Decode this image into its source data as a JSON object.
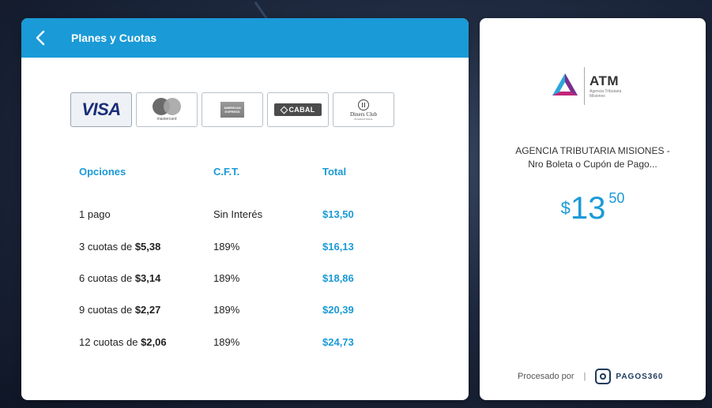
{
  "header": {
    "title": "Planes y Cuotas"
  },
  "cards": {
    "visa": "VISA",
    "mastercard": "mastercard",
    "amex": "AMERICAN EXPRESS",
    "cabal": "CABAL",
    "diners": "Diners Club",
    "diners_sub": "INTERNATIONAL"
  },
  "table": {
    "headers": [
      "Opciones",
      "C.F.T.",
      "Total"
    ],
    "rows": [
      {
        "option_prefix": "1 pago",
        "option_amount": "",
        "cft": "Sin Interés",
        "total": "$13,50"
      },
      {
        "option_prefix": "3 cuotas de ",
        "option_amount": "$5,38",
        "cft": "189%",
        "total": "$16,13"
      },
      {
        "option_prefix": "6 cuotas de ",
        "option_amount": "$3,14",
        "cft": "189%",
        "total": "$18,86"
      },
      {
        "option_prefix": "9 cuotas de ",
        "option_amount": "$2,27",
        "cft": "189%",
        "total": "$20,39"
      },
      {
        "option_prefix": "12 cuotas de ",
        "option_amount": "$2,06",
        "cft": "189%",
        "total": "$24,73"
      }
    ]
  },
  "merchant": {
    "logo_title": "ATM",
    "logo_sub_1": "Agencia Tributaria",
    "logo_sub_2": "Misiones",
    "name_line1": "AGENCIA TRIBUTARIA MISIONES -",
    "name_line2": "Nro Boleta o Cupón de Pago..."
  },
  "amount": {
    "currency": "$",
    "integer": "13",
    "decimal": "50"
  },
  "footer": {
    "processed_by": "Procesado por",
    "separator": "|",
    "brand": "PAGOS360"
  },
  "colors": {
    "accent": "#1a9ad6",
    "brand_dark": "#1d3a5c"
  }
}
